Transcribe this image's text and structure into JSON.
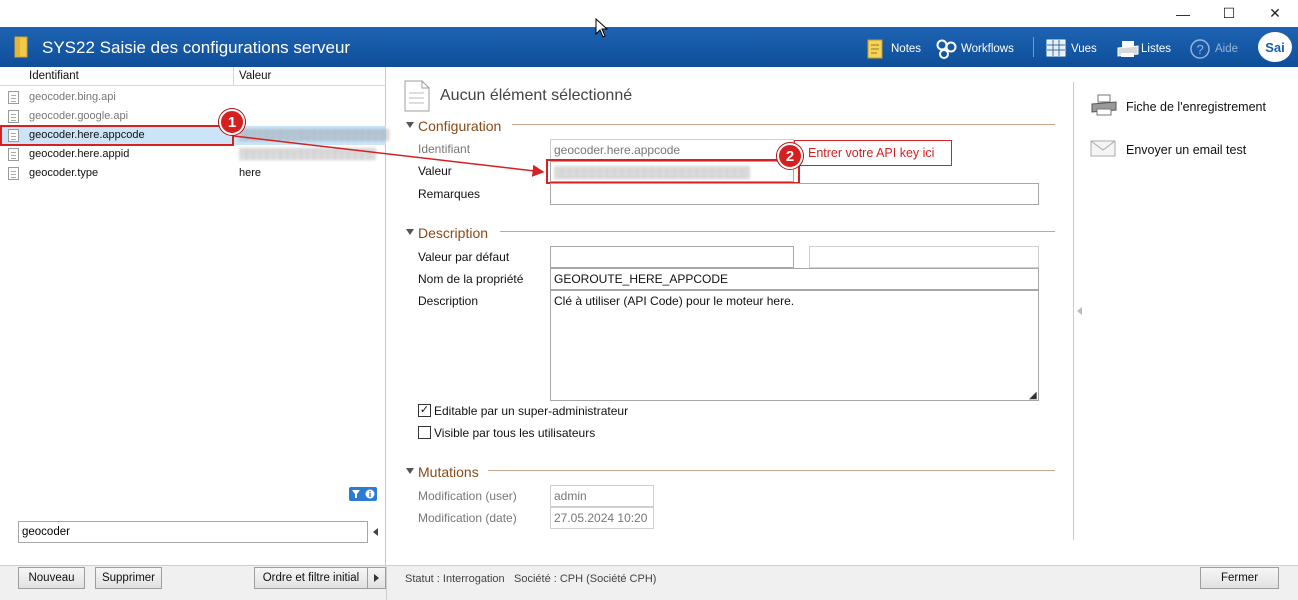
{
  "app": {
    "title": "SYS22 Saisie des configurations serveur"
  },
  "window_controls": {
    "minimize": "—",
    "maximize": "☐",
    "close": "✕"
  },
  "toolbar": {
    "notes": "Notes",
    "workflows": "Workflows",
    "vues": "Vues",
    "listes": "Listes",
    "aide": "Aide",
    "logo": "Sai"
  },
  "list": {
    "columns": {
      "id": "Identifiant",
      "value": "Valeur"
    },
    "rows": [
      {
        "id": "geocoder.bing.api",
        "value": ""
      },
      {
        "id": "geocoder.google.api",
        "value": ""
      },
      {
        "id": "geocoder.here.appcode",
        "value": "▒▒▒▒▒▒▒▒▒▒▒▒▒▒▒▒▒▒▒▒▒▒"
      },
      {
        "id": "geocoder.here.appid",
        "value": "▒▒▒▒▒▒▒▒▒▒▒▒▒▒▒▒▒▒▒▒"
      },
      {
        "id": "geocoder.type",
        "value": "here"
      }
    ],
    "filter_value": "geocoder"
  },
  "buttons": {
    "nouveau": "Nouveau",
    "supprimer": "Supprimer",
    "ordre": "Ordre et filtre initial",
    "fermer": "Fermer"
  },
  "status": {
    "statut": "Statut : Interrogation",
    "societe": "Société : CPH (Société CPH)"
  },
  "detail": {
    "header": "Aucun élément sélectionné",
    "configuration": {
      "title": "Configuration",
      "identifiant_label": "Identifiant",
      "identifiant_value": "geocoder.here.appcode",
      "valeur_label": "Valeur",
      "valeur_value": "▒▒▒▒▒▒▒▒▒▒▒▒▒▒▒▒▒▒▒▒▒▒▒▒▒▒",
      "remarques_label": "Remarques",
      "remarques_value": ""
    },
    "description": {
      "title": "Description",
      "valeur_defaut_label": "Valeur par défaut",
      "valeur_defaut_value": "",
      "nom_label": "Nom de la propriété",
      "nom_value": "GEOROUTE_HERE_APPCODE",
      "description_label": "Description",
      "description_value": "Clé à utiliser (API Code) pour le moteur here.",
      "check_editable": "Editable par un super-administrateur",
      "check_editable_checked": true,
      "check_visible": "Visible par tous les utilisateurs",
      "check_visible_checked": false
    },
    "mutations": {
      "title": "Mutations",
      "user_label": "Modification (user)",
      "user_value": "admin",
      "date_label": "Modification (date)",
      "date_value": "27.05.2024 10:20"
    }
  },
  "actions": {
    "fiche": "Fiche de l'enregistrement",
    "email": "Envoyer un email test"
  },
  "annotations": {
    "marker1": "1",
    "marker2": "2",
    "callout": "Entrer votre API key ici"
  },
  "colors": {
    "header": "#0f4e99",
    "accent_red": "#d32222",
    "section_title": "#8a4a16",
    "selected_row": "#cce4f7"
  }
}
